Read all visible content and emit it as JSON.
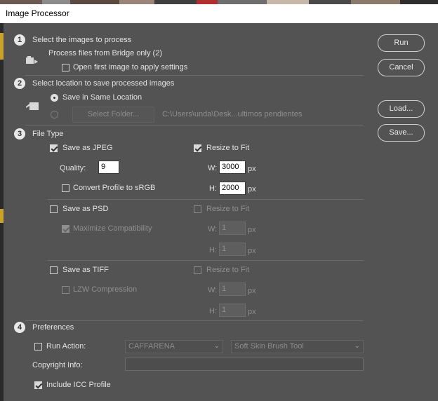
{
  "window": {
    "title": "Image Processor"
  },
  "steps": {
    "s1": {
      "number": "1",
      "heading": "Select the images to process"
    },
    "s2": {
      "number": "2",
      "heading": "Select location to save processed images"
    },
    "s3": {
      "number": "3",
      "heading": "File Type"
    },
    "s4": {
      "number": "4",
      "heading": "Preferences"
    }
  },
  "section1": {
    "source_text": "Process files from Bridge only (2)",
    "open_first_label": "Open first image to apply settings",
    "open_first_checked": false
  },
  "section2": {
    "same_location_label": "Save in Same Location",
    "same_location_selected": true,
    "select_folder_label": "Select Folder...",
    "folder_path": "C:\\Users\\unda\\Desk...ultimos pendientes"
  },
  "jpeg": {
    "save_label": "Save as JPEG",
    "save_checked": true,
    "quality_label": "Quality:",
    "quality_value": "9",
    "convert_label": "Convert Profile to sRGB",
    "convert_checked": false,
    "resize_label": "Resize to Fit",
    "resize_checked": true,
    "w_label": "W:",
    "w_value": "3000",
    "w_unit": "px",
    "h_label": "H:",
    "h_value": "2000",
    "h_unit": "px"
  },
  "psd": {
    "save_label": "Save as PSD",
    "save_checked": false,
    "compat_label": "Maximize Compatibility",
    "compat_checked": true,
    "resize_label": "Resize to Fit",
    "resize_checked": false,
    "w_label": "W:",
    "w_value": "1",
    "w_unit": "px",
    "h_label": "H:",
    "h_value": "1",
    "h_unit": "px"
  },
  "tiff": {
    "save_label": "Save as TIFF",
    "save_checked": false,
    "lzw_label": "LZW Compression",
    "lzw_checked": false,
    "resize_label": "Resize to Fit",
    "resize_checked": false,
    "w_label": "W:",
    "w_value": "1",
    "w_unit": "px",
    "h_label": "H:",
    "h_value": "1",
    "h_unit": "px"
  },
  "preferences": {
    "run_action_label": "Run Action:",
    "run_action_checked": false,
    "action_set": "CAFFARENA",
    "action": "Soft Skin Brush Tool",
    "copyright_label": "Copyright Info:",
    "copyright_value": "",
    "icc_label": "Include ICC Profile",
    "icc_checked": true
  },
  "buttons": {
    "run": "Run",
    "cancel": "Cancel",
    "load": "Load...",
    "save": "Save..."
  },
  "colors": {
    "panel": "#535353",
    "titlebar": "#ffffff",
    "text": "#e3e3e3",
    "disabled_text": "#8f8f8f"
  }
}
